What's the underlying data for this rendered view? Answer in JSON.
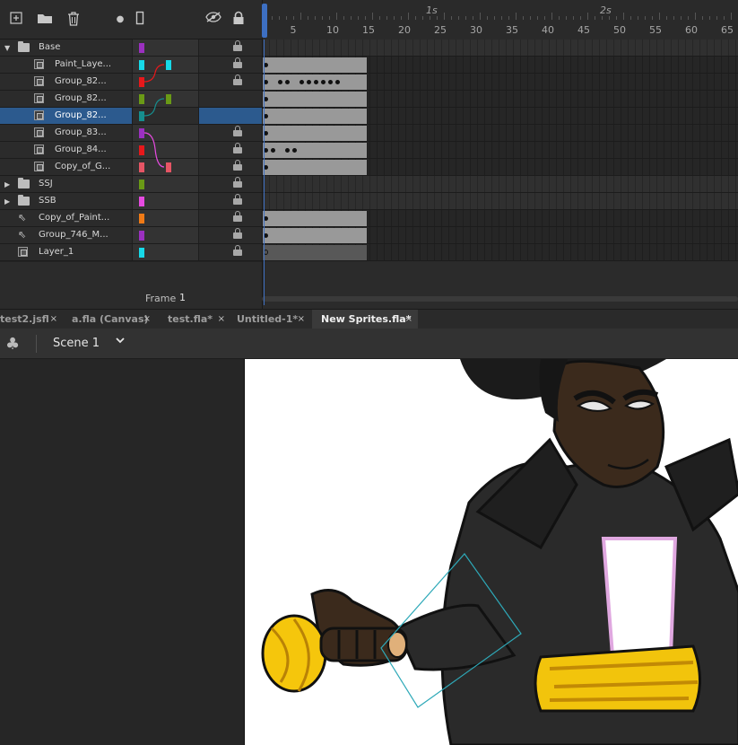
{
  "timeline": {
    "toolbar": {
      "new_layer_icon": "new-layer-icon",
      "new_folder_icon": "new-folder-icon",
      "delete_icon": "trash-icon",
      "dot_icon": "dot-icon",
      "outline_icon": "outline-icon",
      "hide_icon": "eye-hidden-icon",
      "lock_all_icon": "lock-icon"
    },
    "ruler": {
      "seconds": [
        "1s",
        "2s"
      ],
      "frame_numbers": [
        "5",
        "10",
        "15",
        "20",
        "25",
        "30",
        "35",
        "40",
        "45",
        "50",
        "55",
        "60",
        "65"
      ]
    },
    "layers": [
      {
        "name": "Base",
        "kind": "folder",
        "expanded": true,
        "color": "#9b30c0",
        "locked": true
      },
      {
        "name": "Paint_Laye...",
        "kind": "layer",
        "color": "#17d9e8",
        "locked": true
      },
      {
        "name": "Group_82...",
        "kind": "layer",
        "color": "#e8181b",
        "locked": true
      },
      {
        "name": "Group_82...",
        "kind": "layer",
        "color": "#6a9a16",
        "locked": false
      },
      {
        "name": "Group_82...",
        "kind": "layer",
        "color": "#168e8e",
        "locked": false,
        "selected": true
      },
      {
        "name": "Group_83...",
        "kind": "layer",
        "color": "#9b30c0",
        "locked": true
      },
      {
        "name": "Group_84...",
        "kind": "layer",
        "color": "#e8181b",
        "locked": true
      },
      {
        "name": "Copy_of_G...",
        "kind": "layer",
        "color": "#e65565",
        "locked": true
      },
      {
        "name": "SSJ",
        "kind": "folder",
        "expanded": false,
        "color": "#6a9a16",
        "locked": true
      },
      {
        "name": "SSB",
        "kind": "folder",
        "expanded": false,
        "color": "#e64ae0",
        "locked": true
      },
      {
        "name": "Copy_of_Paint...",
        "kind": "guide",
        "color": "#f07a16",
        "locked": true
      },
      {
        "name": "Group_746_M...",
        "kind": "guide",
        "color": "#9b30c0",
        "locked": true
      },
      {
        "name": "Layer_1",
        "kind": "layer",
        "color": "#17d9e8",
        "locked": true
      }
    ],
    "frame_label": "Frame",
    "frame_value": "1"
  },
  "tabs": [
    {
      "label": "test2.jsfl",
      "active": false
    },
    {
      "label": "a.fla (Canvas)",
      "active": false
    },
    {
      "label": "test.fla*",
      "active": false
    },
    {
      "label": "Untitled-1*",
      "active": false
    },
    {
      "label": "New Sprites.fla*",
      "active": true
    }
  ],
  "tab_close": "×",
  "scene": {
    "icon": "club-icon",
    "name": "Scene 1",
    "chevron": "chevron-down-icon"
  },
  "colors": {
    "accent": "#3d6fc2",
    "selected_row": "#2c5a8e",
    "panel": "#2b2b2b"
  }
}
